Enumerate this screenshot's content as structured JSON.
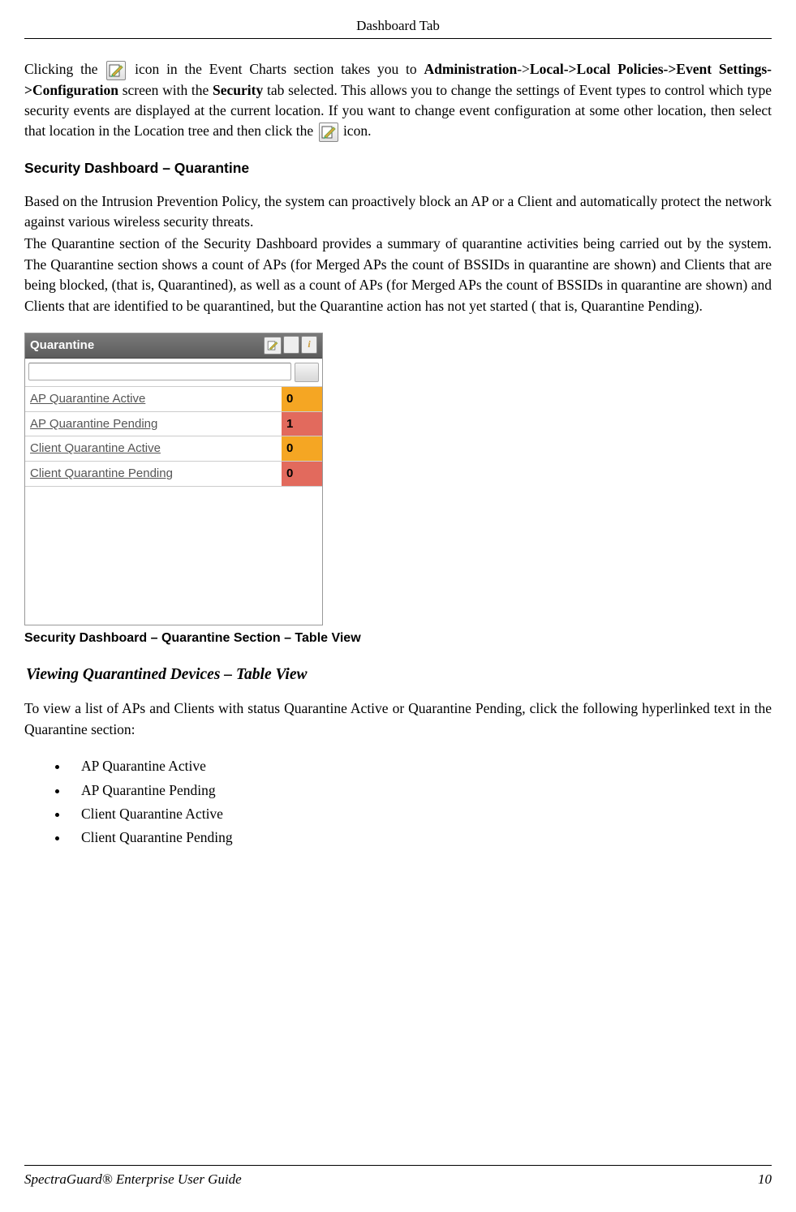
{
  "header": {
    "title": "Dashboard Tab"
  },
  "para1": {
    "prefix": "Clicking the ",
    "mid": " icon in the Event Charts section takes you to ",
    "boldpath_a": "Administration",
    "sep": "->",
    "boldpath_b": "Local->Local Policies->Event Settings->Configuration",
    "after_path": " screen with the ",
    "bold_sec": "Security",
    "tail1": " tab selected. This allows you to change the settings of Event types to control which type security events are displayed at the current location. If you want to change event configuration at some other location, then select that location in the Location tree and then click the ",
    "tail2": " icon."
  },
  "heading1": "Security Dashboard – Quarantine",
  "para2": "Based on the Intrusion Prevention Policy, the system can proactively block an AP or a Client and automatically protect the network against various wireless security threats.",
  "para3": "The Quarantine section of the Security Dashboard provides a summary of quarantine activities being carried out by the system. The Quarantine section shows a count of APs (for Merged APs the count of BSSIDs in quarantine are shown) and Clients that are being blocked, (that is, Quarantined), as well as a count of APs (for Merged APs the count of BSSIDs in quarantine are shown) and Clients that are identified to be quarantined, but the Quarantine action has not yet started ( that is, Quarantine Pending).",
  "quarantine": {
    "title": "Quarantine",
    "rows": [
      {
        "label": "AP Quarantine Active",
        "value": "0",
        "color": "bg-yellow"
      },
      {
        "label": "AP Quarantine Pending",
        "value": "1",
        "color": "bg-red"
      },
      {
        "label": "Client Quarantine Active",
        "value": "0",
        "color": "bg-yellow"
      },
      {
        "label": "Client Quarantine Pending",
        "value": "0",
        "color": "bg-red"
      }
    ]
  },
  "caption1": "Security Dashboard – Quarantine Section – Table View",
  "subheading": "Viewing Quarantined Devices – Table View",
  "para4": "To view a list of APs and Clients with status Quarantine Active or Quarantine Pending, click the following hyperlinked text in the Quarantine section:",
  "bullets": [
    "AP Quarantine Active",
    "AP Quarantine Pending",
    "Client Quarantine Active",
    "Client Quarantine Pending"
  ],
  "footer": {
    "left": "SpectraGuard® Enterprise User Guide",
    "right": "10"
  }
}
